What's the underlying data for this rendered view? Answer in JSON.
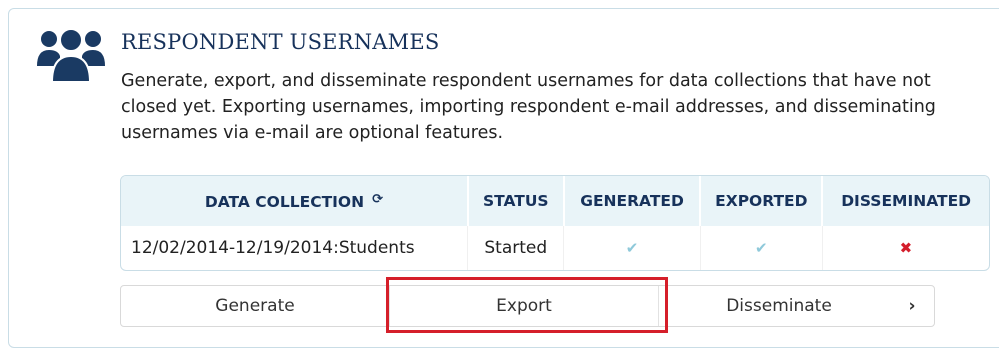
{
  "section": {
    "title": "RESPONDENT USERNAMES",
    "description": "Generate, export, and disseminate respondent usernames for data collections that have not closed yet. Exporting usernames, importing respondent e-mail addresses, and disseminating usernames via e-mail are optional features.",
    "icon": "users-group-icon"
  },
  "table": {
    "headers": [
      "DATA COLLECTION",
      "STATUS",
      "GENERATED",
      "EXPORTED",
      "DISSEMINATED"
    ],
    "sort_icon": "⟳",
    "rows": [
      {
        "data_collection": "12/02/2014-12/19/2014:Students",
        "status": "Started",
        "generated": "✔",
        "exported": "✔",
        "disseminated": "✖"
      }
    ]
  },
  "actions": {
    "generate_label": "Generate",
    "export_label": "Export",
    "disseminate_label": "Disseminate",
    "next_label": "›"
  },
  "colors": {
    "brand_navy": "#17325b",
    "header_bg": "#e9f4f8",
    "check": "#8fc9da",
    "cross": "#d41e2c",
    "highlight": "#d51f2a"
  }
}
